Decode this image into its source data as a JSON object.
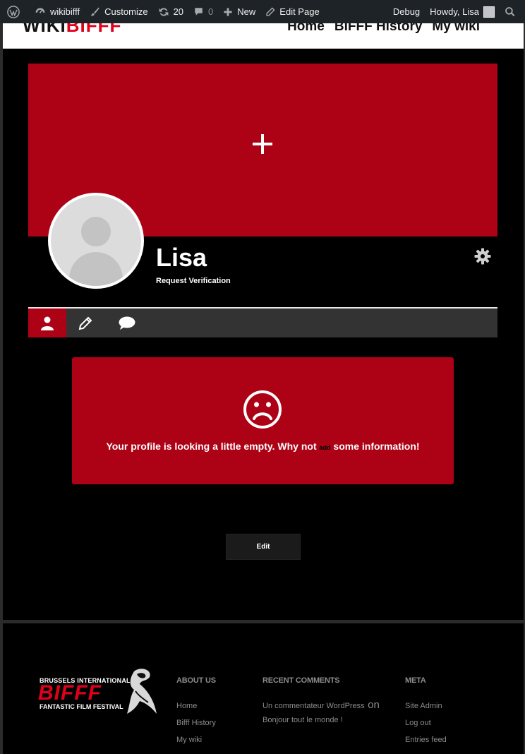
{
  "adminbar": {
    "site_name": "wikibifff",
    "customize": "Customize",
    "updates": "20",
    "comments": "0",
    "new": "New",
    "edit_page": "Edit Page",
    "debug": "Debug",
    "howdy": "Howdy, Lisa"
  },
  "header": {
    "logo_text_dark": "WIKI",
    "logo_text_red": "BIFFF",
    "nav": [
      "Home",
      "BIFFF History",
      "My wiki"
    ]
  },
  "profile": {
    "name": "Lisa",
    "verification_link": "Request Verification",
    "empty_message_before": "Your profile is looking a little empty. Why not",
    "empty_message_link": "add",
    "empty_message_after": "some information!",
    "edit_button": "Edit"
  },
  "footer": {
    "logo_line1": "BRUSSELS INTERNATIONAL",
    "logo_line2": "BIFFF",
    "logo_line3": "FANTASTIC FILM FESTIVAL",
    "about": {
      "title": "ABOUT US",
      "links": [
        "Home",
        "Bifff History",
        "My wiki"
      ]
    },
    "recent": {
      "title": "RECENT COMMENTS",
      "author": "Un commentateur WordPress",
      "on": "on",
      "post": "Bonjour tout le monde !"
    },
    "meta": {
      "title": "META",
      "links": [
        "Site Admin",
        "Log out",
        "Entries feed"
      ]
    }
  },
  "colors": {
    "accent_red": "#ad0116",
    "adminbar_bg": "#1d2327"
  }
}
